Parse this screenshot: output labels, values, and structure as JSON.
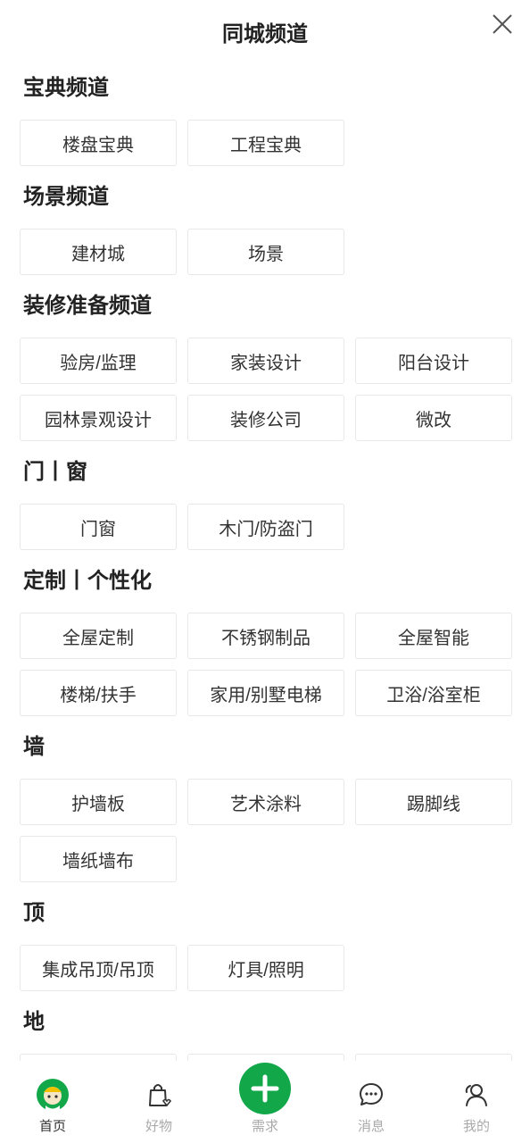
{
  "header": {
    "title": "同城频道"
  },
  "sections": [
    {
      "title": "宝典频道",
      "items": [
        "楼盘宝典",
        "工程宝典"
      ]
    },
    {
      "title": "场景频道",
      "items": [
        "建材城",
        "场景"
      ]
    },
    {
      "title": "装修准备频道",
      "items": [
        "验房/监理",
        "家装设计",
        "阳台设计",
        "园林景观设计",
        "装修公司",
        "微改"
      ]
    },
    {
      "title": "门丨窗",
      "items": [
        "门窗",
        "木门/防盗门"
      ]
    },
    {
      "title": "定制丨个性化",
      "items": [
        "全屋定制",
        "不锈钢制品",
        "全屋智能",
        "楼梯/扶手",
        "家用/别墅电梯",
        "卫浴/浴室柜"
      ]
    },
    {
      "title": "墙",
      "items": [
        "护墙板",
        "艺术涂料",
        "踢脚线",
        "墙纸墙布"
      ]
    },
    {
      "title": "顶",
      "items": [
        "集成吊顶/吊顶",
        "灯具/照明"
      ]
    },
    {
      "title": "地",
      "items": [
        "",
        "",
        ""
      ]
    }
  ],
  "tabbar": {
    "home": "首页",
    "goods": "好物",
    "demand": "需求",
    "messages": "消息",
    "mine": "我的"
  },
  "colors": {
    "accent": "#12a84a"
  }
}
